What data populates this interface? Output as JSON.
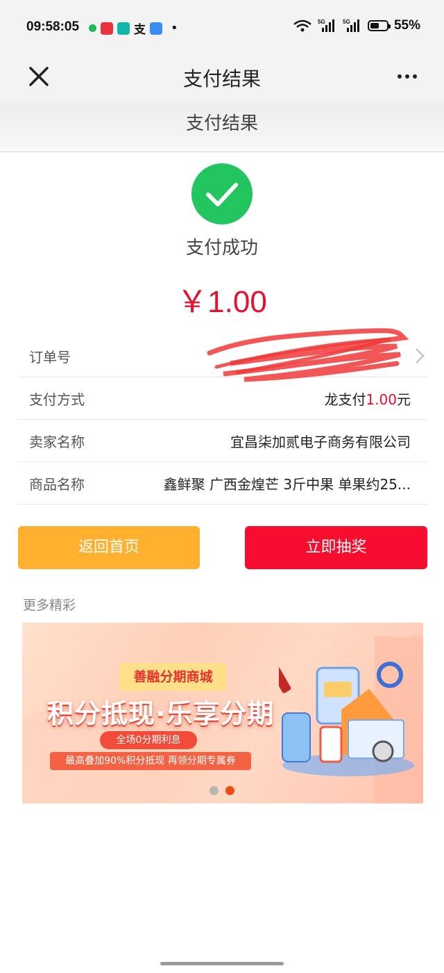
{
  "status_bar": {
    "time": "09:58:05",
    "more": "•",
    "signal1_label": "5G",
    "signal2_label": "5G",
    "battery_percent": "55%",
    "battery_level": 0.55
  },
  "nav": {
    "title": "支付结果"
  },
  "page_header": {
    "title": "支付结果"
  },
  "result": {
    "status_text": "支付成功",
    "amount": "￥1.00"
  },
  "details": {
    "order_label": "订单号",
    "payment_label": "支付方式",
    "payment_prefix": "龙支付",
    "payment_amount": "1.00",
    "payment_suffix": "元",
    "seller_label": "卖家名称",
    "seller_value": "宜昌柒加贰电子商务有限公司",
    "product_label": "商品名称",
    "product_value": "鑫鲜聚 广西金煌芒 3斤中果 单果约25..."
  },
  "buttons": {
    "home": "返回首页",
    "lottery": "立即抽奖"
  },
  "more": {
    "title": "更多精彩"
  },
  "banner": {
    "tag": "善融分期商城",
    "headline": "积分抵现·乐享分期",
    "pill": "全场0分期利息",
    "strip": "最高叠加90%积分抵现 再领分期专属券",
    "pages": 2,
    "active_page": 2
  },
  "colors": {
    "success": "#22c55e",
    "amount": "#e60f2d",
    "home_button": "#ffb02e",
    "lottery_button": "#f70d2d"
  }
}
